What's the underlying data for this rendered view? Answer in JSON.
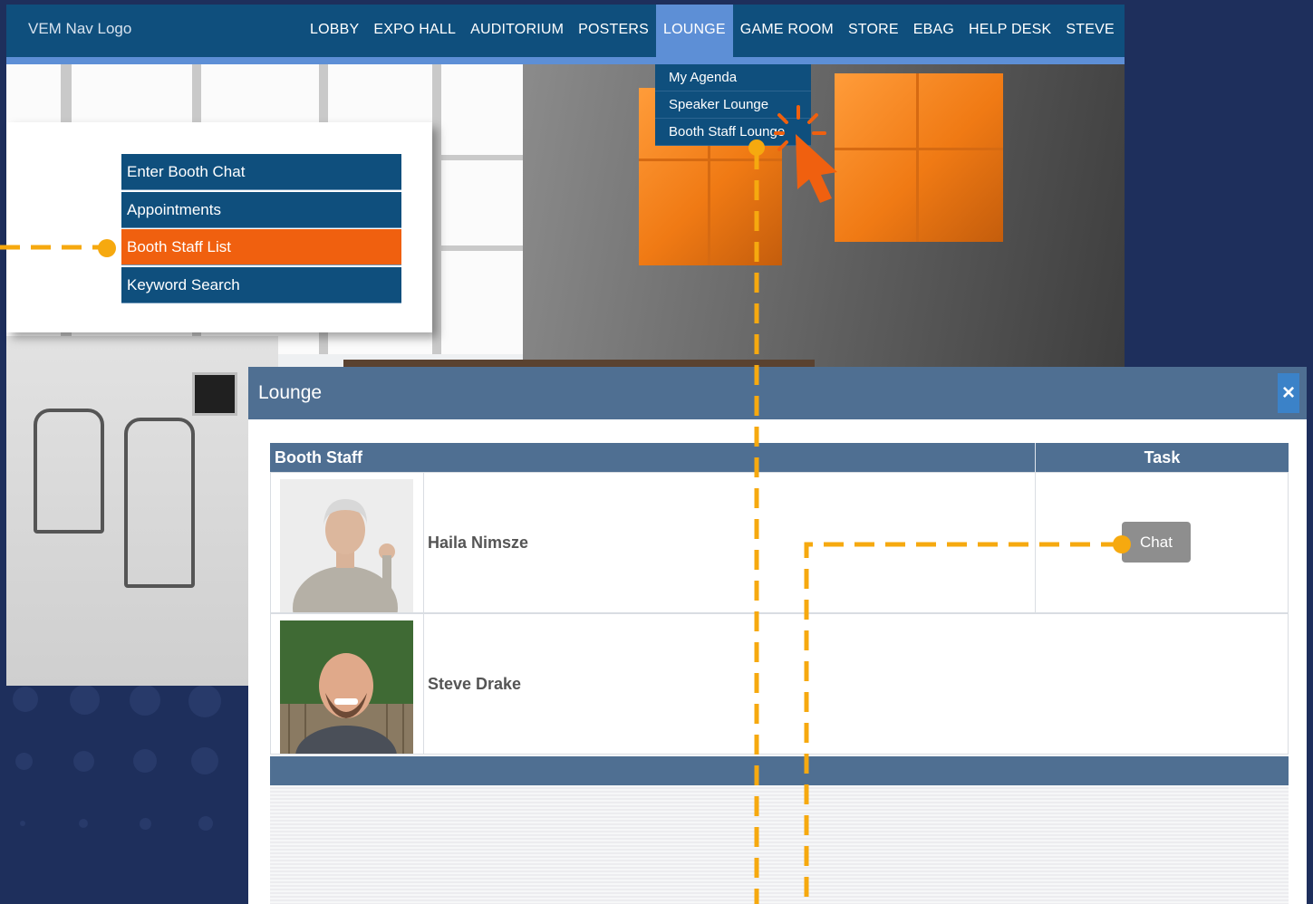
{
  "nav": {
    "logo": "VEM Nav Logo",
    "links": [
      "LOBBY",
      "EXPO HALL",
      "AUDITORIUM",
      "POSTERS",
      "LOUNGE",
      "GAME ROOM",
      "STORE",
      "EBAG",
      "HELP DESK",
      "STEVE"
    ],
    "active": "LOUNGE",
    "dropdown": [
      "My Agenda",
      "Speaker Lounge",
      "Booth Staff Lounge"
    ]
  },
  "booth_menu": {
    "items": [
      "Enter Booth Chat",
      "Appointments",
      "Booth Staff List",
      "Keyword Search"
    ],
    "active": "Booth Staff List"
  },
  "lounge": {
    "title": "Lounge",
    "close_label": "×",
    "columns": [
      "Booth Staff",
      "Task"
    ],
    "staff": [
      {
        "name": "Haila Nimsze",
        "task_button": "Chat"
      },
      {
        "name": "Steve Drake",
        "task_button": ""
      }
    ]
  },
  "colors": {
    "nav_bg": "#0f4f7d",
    "nav_active": "#5d8fd6",
    "accent_orange": "#f0600f",
    "panel_header": "#4f6f92",
    "annotation": "#f6a90f",
    "page_bg": "#1e2f5c"
  },
  "icons": {
    "close": "close-icon",
    "cursor": "cursor-click-icon"
  }
}
